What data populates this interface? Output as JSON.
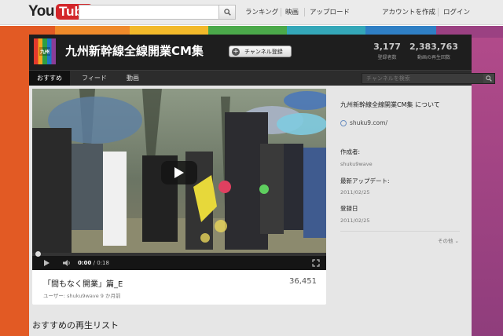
{
  "masthead": {
    "logo_you": "You",
    "logo_tube": "Tube",
    "search_placeholder": "",
    "nav": [
      "ランキング",
      "映画",
      "アップロード"
    ],
    "account": [
      "アカウントを作成",
      "ログイン"
    ]
  },
  "channel": {
    "avatar_text": "九州",
    "title": "九州新幹線全線開業CM集",
    "subscribe_label": "チャンネル登録",
    "stats": [
      {
        "value": "3,177",
        "label": "登録者数"
      },
      {
        "value": "2,383,763",
        "label": "動画の再生回数"
      }
    ]
  },
  "tabs": [
    {
      "label": "おすすめ",
      "active": true
    },
    {
      "label": "フィード",
      "active": false
    },
    {
      "label": "動画",
      "active": false
    }
  ],
  "channel_search_placeholder": "チャンネルを検索",
  "player": {
    "time_current": "0:00",
    "time_total": "/ 0:18",
    "progress": 0
  },
  "video": {
    "title": "「間もなく開業」篇_E",
    "views": "36,451",
    "meta": "ユーザー: shuku9wave 9 か月前"
  },
  "about": {
    "title": "九州新幹線全線開業CM集 について",
    "link": "shuku9.com/",
    "author_label": "作成者:",
    "author": "shuku9wave",
    "updated_label": "最新アップデート:",
    "updated": "2011/02/25",
    "joined_label": "登録日",
    "joined": "2011/02/25",
    "more": "その他"
  },
  "playlist_heading": "おすすめの再生リスト",
  "colors": {
    "accent_red": "#d3262a",
    "header_dark": "#1e1e1e",
    "bg_orange": "#e25a24",
    "bg_purple": "#9b4182"
  }
}
